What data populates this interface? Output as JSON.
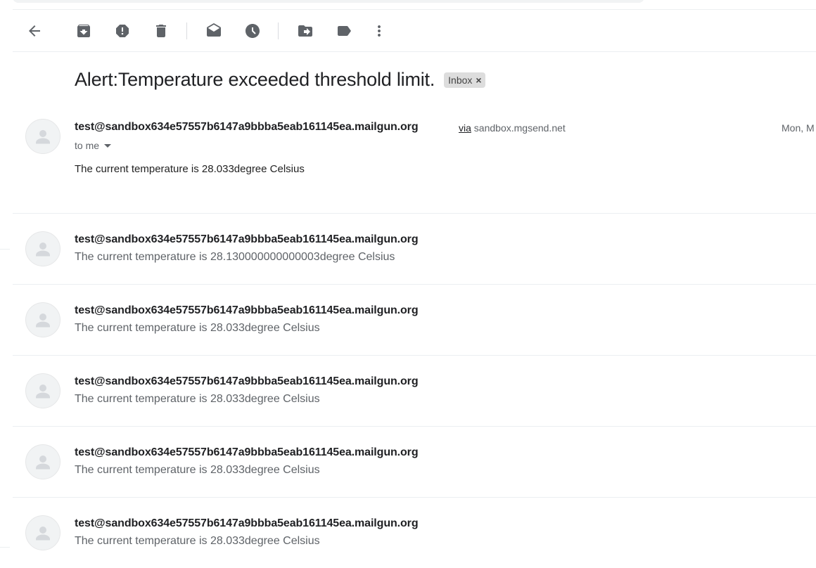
{
  "toolbar": {
    "buttons": [
      {
        "name": "back-button",
        "icon": "arrow-back-icon"
      },
      {
        "name": "archive-button",
        "icon": "archive-icon"
      },
      {
        "name": "report-spam-button",
        "icon": "report-icon"
      },
      {
        "name": "delete-button",
        "icon": "trash-icon"
      },
      {
        "name": "mark-unread-button",
        "icon": "mark-unread-icon"
      },
      {
        "name": "snooze-button",
        "icon": "clock-icon"
      },
      {
        "name": "move-to-button",
        "icon": "move-to-folder-icon"
      },
      {
        "name": "labels-button",
        "icon": "label-icon"
      },
      {
        "name": "more-button",
        "icon": "more-vert-icon"
      }
    ]
  },
  "thread": {
    "subject": "Alert:Temperature exceeded threshold limit.",
    "label": "Inbox",
    "label_remove": "×"
  },
  "expanded_message": {
    "sender": "test@sandbox634e57557b6147a9bbba5eab161145ea.mailgun.org",
    "via_word": "via",
    "via_domain": "sandbox.mgsend.net",
    "date": "Mon, M",
    "recipient": "to me",
    "body": "The current temperature is 28.033degree Celsius"
  },
  "collapsed_messages": [
    {
      "sender": "test@sandbox634e57557b6147a9bbba5eab161145ea.mailgun.org",
      "snippet": "The current temperature is 28.130000000000003degree Celsius"
    },
    {
      "sender": "test@sandbox634e57557b6147a9bbba5eab161145ea.mailgun.org",
      "snippet": "The current temperature is 28.033degree Celsius"
    },
    {
      "sender": "test@sandbox634e57557b6147a9bbba5eab161145ea.mailgun.org",
      "snippet": "The current temperature is 28.033degree Celsius"
    },
    {
      "sender": "test@sandbox634e57557b6147a9bbba5eab161145ea.mailgun.org",
      "snippet": "The current temperature is 28.033degree Celsius"
    },
    {
      "sender": "test@sandbox634e57557b6147a9bbba5eab161145ea.mailgun.org",
      "snippet": "The current temperature is 28.033degree Celsius"
    }
  ],
  "colors": {
    "icon": "#5f6368",
    "text": "#202124",
    "muted": "#5f6368",
    "label_chip": "#dddddd",
    "divider": "#eceff1"
  }
}
